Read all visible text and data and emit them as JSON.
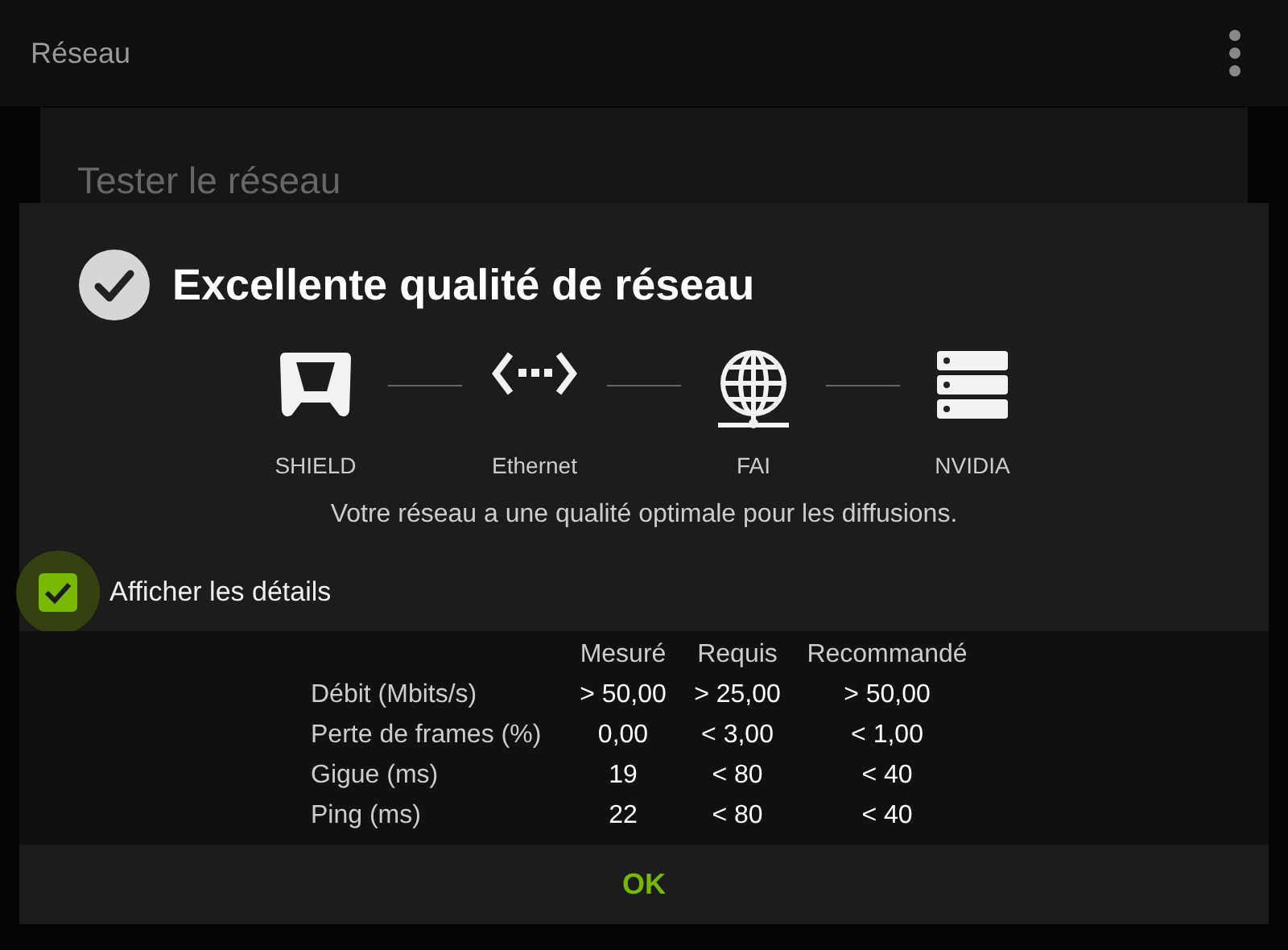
{
  "app_bar": {
    "title": "Réseau"
  },
  "background_card": {
    "title": "Tester le réseau"
  },
  "dialog": {
    "title": "Excellente qualité de réseau",
    "path": [
      {
        "kind": "controller",
        "label": "SHIELD"
      },
      {
        "kind": "ethernet",
        "label": "Ethernet"
      },
      {
        "kind": "globe",
        "label": "FAI"
      },
      {
        "kind": "server",
        "label": "NVIDIA"
      }
    ],
    "message": "Votre réseau a une qualité optimale pour les diffusions.",
    "details_toggle": {
      "label": "Afficher les détails",
      "checked": true,
      "focused": true
    },
    "table": {
      "columns": [
        "Mesuré",
        "Requis",
        "Recommandé"
      ],
      "rows": [
        {
          "label": "Débit (Mbits/s)",
          "values": [
            "> 50,00",
            "> 25,00",
            "> 50,00"
          ]
        },
        {
          "label": "Perte de frames (%)",
          "values": [
            "0,00",
            "< 3,00",
            "< 1,00"
          ]
        },
        {
          "label": "Gigue (ms)",
          "values": [
            "19",
            "< 80",
            "< 40"
          ]
        },
        {
          "label": "Ping (ms)",
          "values": [
            "22",
            "< 80",
            "< 40"
          ]
        }
      ]
    },
    "button": "OK"
  }
}
